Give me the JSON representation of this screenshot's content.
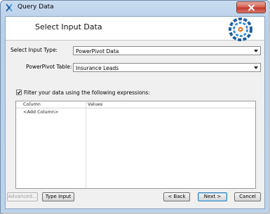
{
  "window": {
    "title": "Query Data",
    "close_icon": "close-icon",
    "app_icon": "query-data-app-icon"
  },
  "header": {
    "title": "Select Input Data",
    "logo_icon": "data-mining-logo-icon"
  },
  "form": {
    "input_type_label": "Select Input Type:",
    "input_type_value": "PowerPivot Data",
    "table_label": "PowerPivot Table:",
    "table_value": "Insurance Leads",
    "filter_checked": true,
    "filter_label": "Filter your data  using the following expressions:"
  },
  "grid": {
    "columns": [
      "Column",
      "Values"
    ],
    "rows": [
      {
        "column": "<Add Column>",
        "values": ""
      }
    ]
  },
  "buttons": {
    "advanced": "Advanced...",
    "type_input": "Type Input",
    "back": "< Back",
    "next": "Next >",
    "cancel": "Cancel"
  },
  "colors": {
    "title_bar": "#bcd3ec",
    "close_button": "#c0392b",
    "accent": "#3c7fb1"
  }
}
